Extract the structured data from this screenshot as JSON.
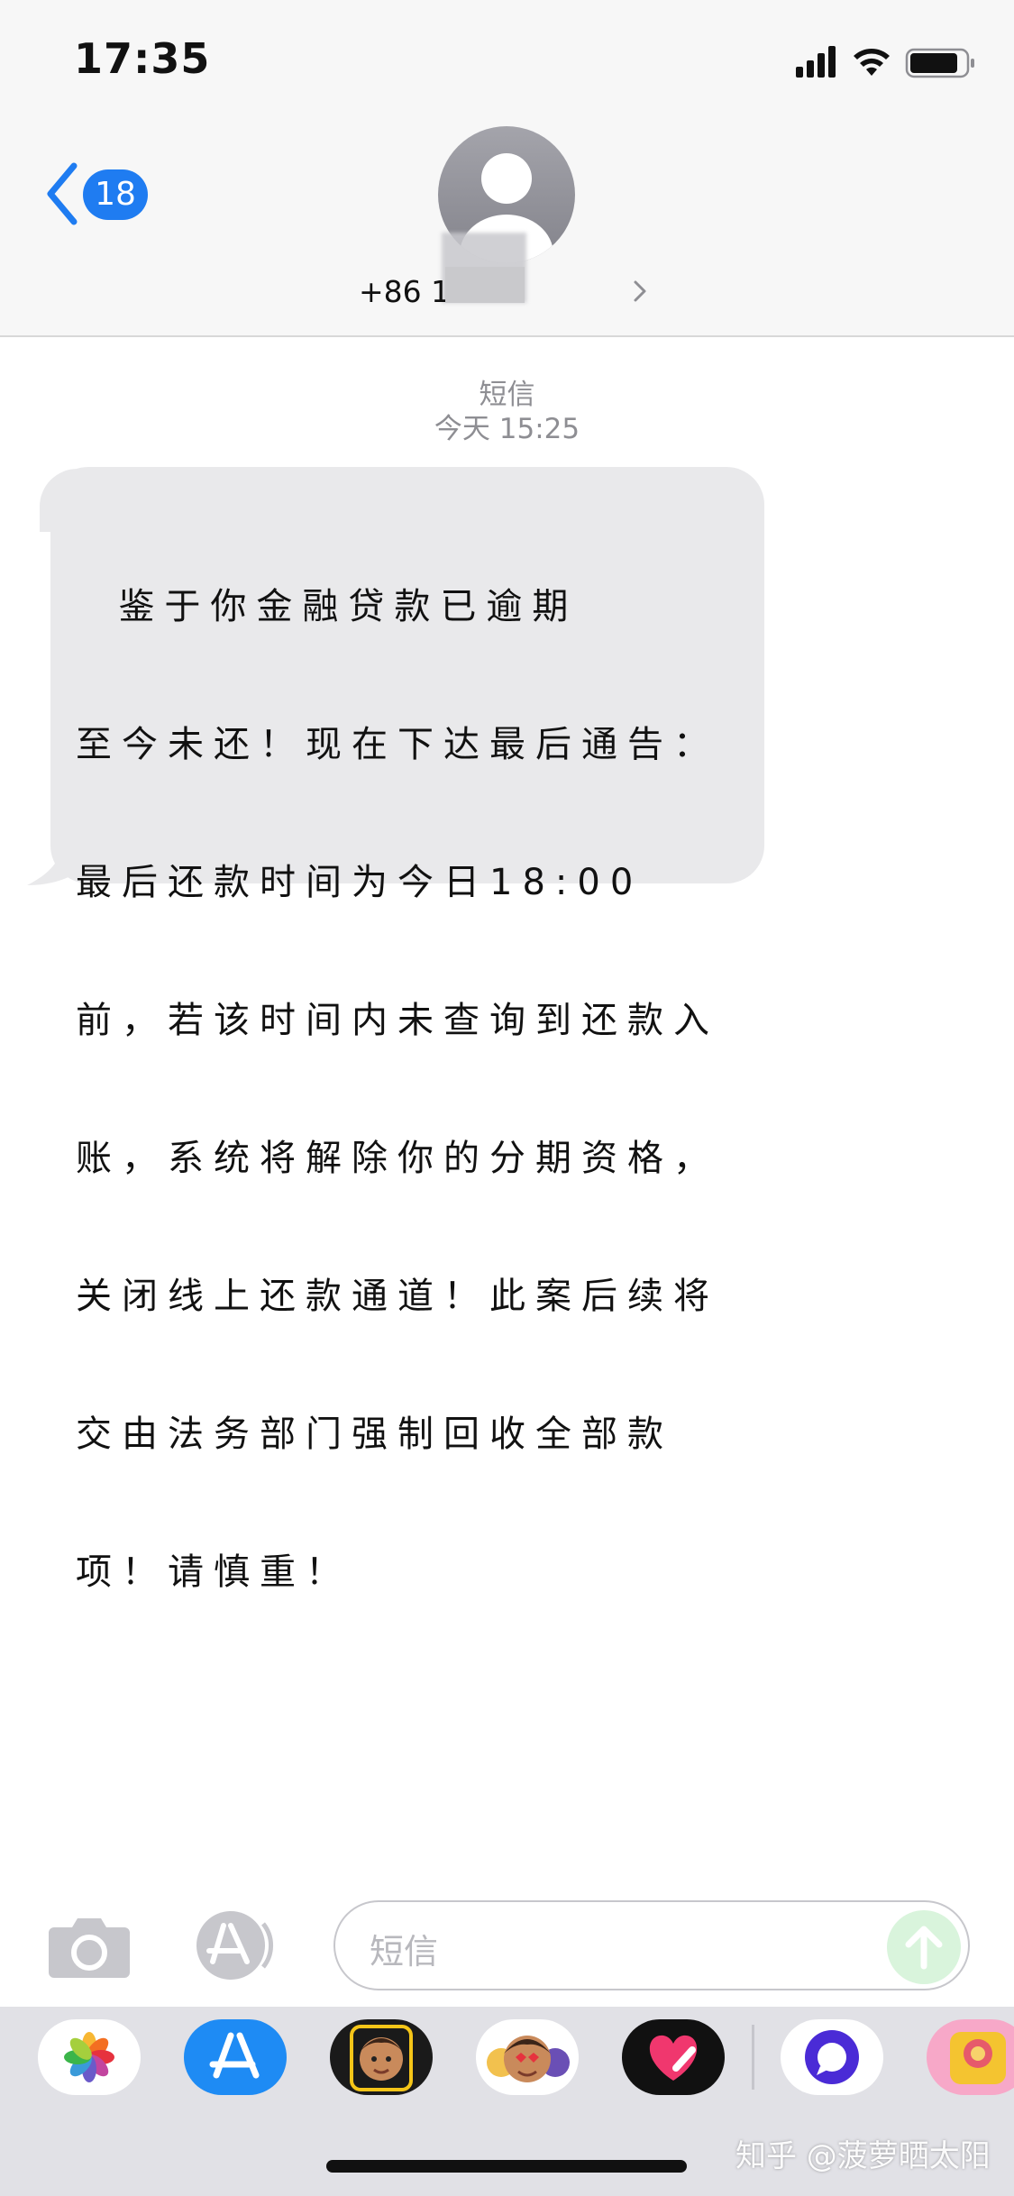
{
  "status_bar": {
    "time": "17:35",
    "signal_icon": "cellular-signal-icon",
    "wifi_icon": "wifi-icon",
    "battery_icon": "battery-icon"
  },
  "header": {
    "back_icon": "chevron-left-icon",
    "unread_count": "18",
    "avatar_icon": "person-avatar-icon",
    "contact_name": "+86 13",
    "detail_icon": "chevron-right-icon"
  },
  "thread": {
    "service_label": "短信",
    "timestamp": "今天 15:25"
  },
  "message": {
    "text": "鉴于你金融贷款已逾期至今未还！现在下达最后通告：最后还款时间为今日18:00前，若该时间内未查询到还款入账，系统将解除你的分期资格，关闭线上还款通道！此案后续将交由法务部门强制回收全部款项！请慎重！",
    "lines": [
      "  鉴于你金融贷款已逾期",
      "至今未还！现在下达最后通告：",
      "最后还款时间为今日18:00",
      "前，若该时间内未查询到还款入",
      "账，系统将解除你的分期资格，",
      "关闭线上还款通道！此案后续将",
      "交由法务部门强制回收全部款",
      "项！请慎重！"
    ]
  },
  "input_bar": {
    "camera_icon": "camera-icon",
    "apps_icon": "app-store-icon",
    "placeholder": "短信",
    "send_icon": "arrow-up-icon"
  },
  "app_drawer": {
    "apps": [
      "photos-icon",
      "app-store-icon",
      "memoji-icon",
      "animoji-icon",
      "heart-digital-touch-icon",
      "search-bubble-icon",
      "meet-you-icon"
    ]
  },
  "colors": {
    "accent": "#1f7cf1",
    "bubble_received": "#e9e9eb",
    "header_bg": "#f7f7f7",
    "drawer_bg": "#e1e1e6"
  },
  "watermark": "知乎 @菠萝晒太阳"
}
